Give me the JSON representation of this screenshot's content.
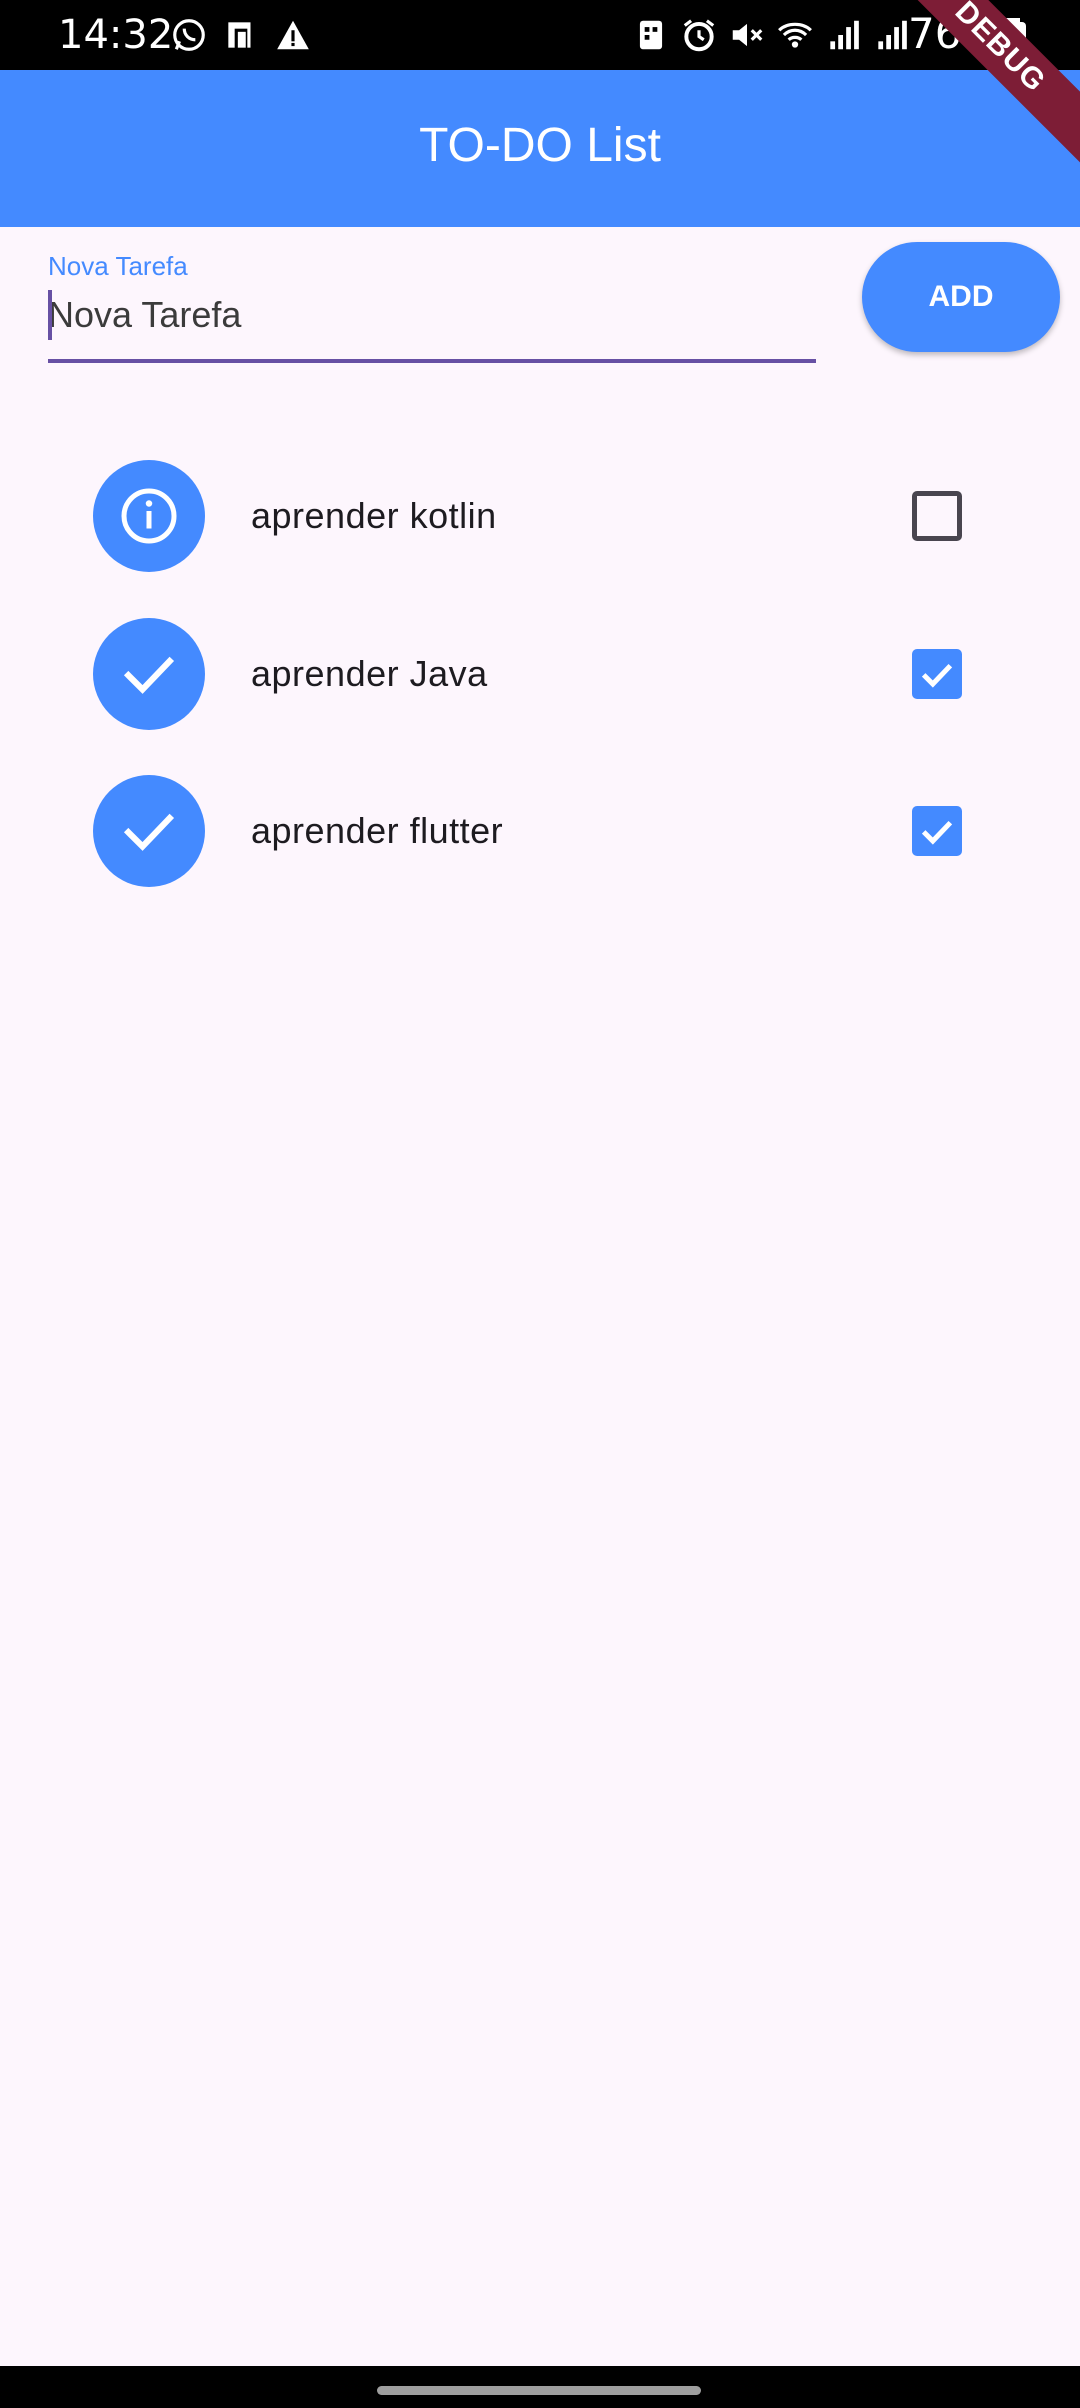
{
  "status_bar": {
    "time": "14:32",
    "battery": "76%",
    "left_icons": [
      "whatsapp-icon",
      "clipboard-icon",
      "warning-icon"
    ],
    "right_icons": [
      "building-icon",
      "alarm-icon",
      "mute-icon",
      "wifi-icon",
      "signal-icon",
      "signal-icon-2"
    ]
  },
  "debug_banner": "DEBUG",
  "app_bar": {
    "title": "TO-DO List",
    "color": "#448aff"
  },
  "new_task": {
    "label": "Nova Tarefa",
    "value": "Nova Tarefa",
    "add_label": "ADD"
  },
  "todos": [
    {
      "title": "aprender kotlin",
      "done": false,
      "icon": "info-icon"
    },
    {
      "title": "aprender Java",
      "done": true,
      "icon": "check-icon"
    },
    {
      "title": "aprender flutter",
      "done": true,
      "icon": "check-icon"
    }
  ]
}
